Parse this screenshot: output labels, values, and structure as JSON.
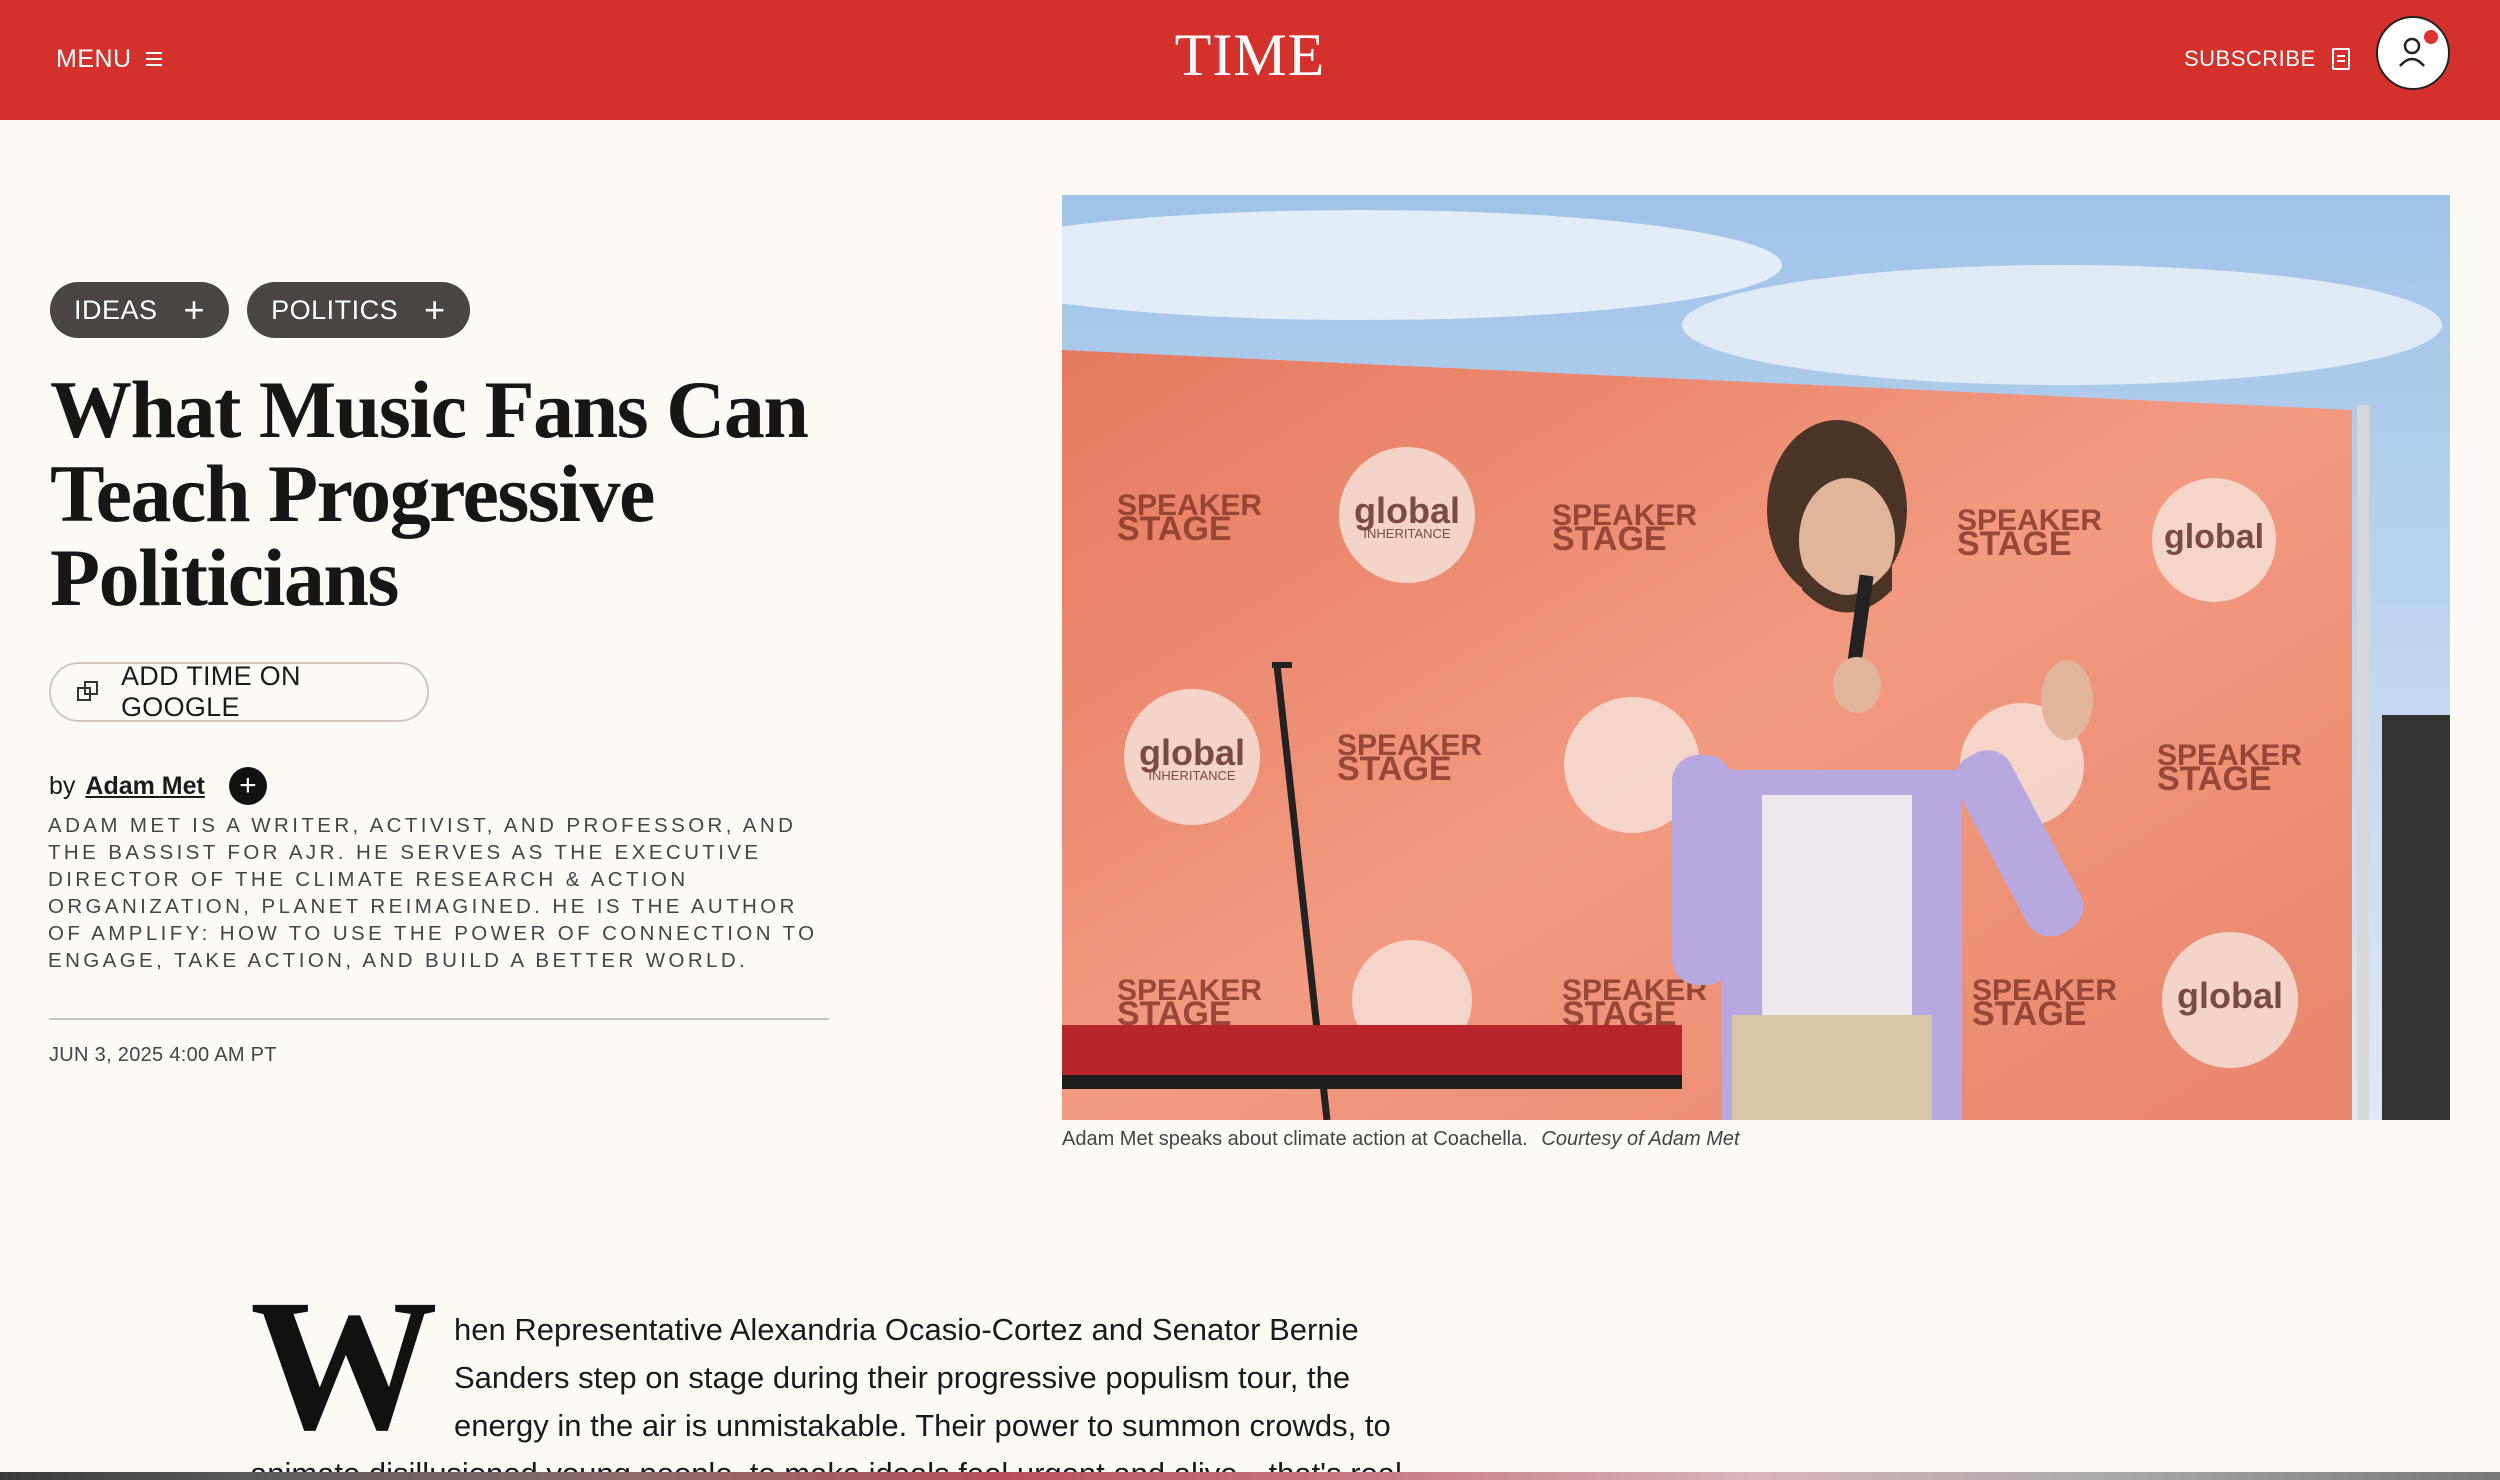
{
  "header": {
    "menu_label": "MENU",
    "logo": "TIME",
    "subscribe_label": "SUBSCRIBE",
    "accent_color": "#d5312c"
  },
  "article": {
    "tags": [
      {
        "label": "IDEAS"
      },
      {
        "label": "POLITICS"
      }
    ],
    "headline": "What Music Fans Can Teach Progressive Politicians",
    "add_google_label": "ADD TIME ON GOOGLE",
    "by": "by",
    "author": "Adam Met",
    "bio": "Adam Met is a writer, activist, and professor, and the bassist for AJR. He serves as the Executive Director of the climate research & action organization, Planet Reimagined. He is the author of Amplify: How to Use the Power of Connection to Engage, Take Action, and Build a Better World.",
    "date": "JUN 3, 2025 4:00 AM PT",
    "image": {
      "caption": "Adam Met speaks about climate action at Coachella.",
      "credit": "Courtesy of Adam Met",
      "banner_texts": {
        "speaker": "SPEAKER",
        "stage": "STAGE",
        "global": "global",
        "inheritance": "INHERITANCE"
      }
    },
    "body": {
      "dropcap": "W",
      "first_paragraph": "hen Representative Alexandria Ocasio-Cortez and Senator Bernie Sanders step on stage during their progressive populism tour, the energy in the air is unmistakable. Their power to summon crowds, to",
      "cut_line": "animate disillusioned young people, to make ideals feel urgent and alive—that's real"
    }
  }
}
